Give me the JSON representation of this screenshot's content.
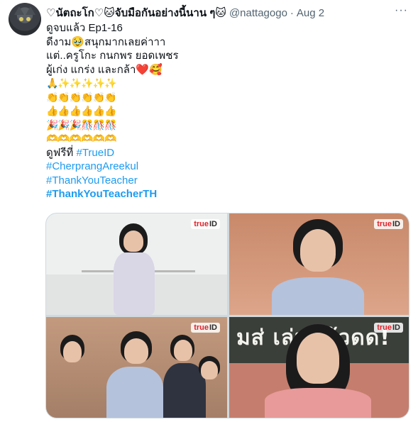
{
  "tweet": {
    "display_name": "♡นัตถะโก♡🐱จับมือกันอย่างนี้นาน ๆ🐱",
    "handle": "@nattagogo",
    "separator": "·",
    "date": "Aug 2",
    "more_label": "···",
    "lines": [
      "ดูจบแล้ว  Ep1-16",
      "ดีงาม🥹สนุกมากเลยค่าาา",
      "แต่..ครูโกะ กนกพร  ยอดเพชร",
      "ผู้เก่ง แกร่ง และกล้า❤️🥰"
    ],
    "emoji_rows": [
      "🙏✨✨✨✨✨",
      "👏👏👏👏👏👏",
      "👍👍👍👍👍👍",
      "🎉🎉🎉🎊🎊🎊",
      "🫶🫶🫶🫶🫶🫶"
    ],
    "watch_text": "ดูฟรีที่ ",
    "hashtags": {
      "trueid": "#TrueID",
      "cherprang": "#CherprangAreekul",
      "thankyou": "#ThankYouTeacher",
      "thankyou_th": "#ThankYouTeacherTH"
    }
  },
  "media": {
    "logo_true": "true",
    "logo_id": "ID",
    "chalk_text": "มส่ เล่นแล้วดด!"
  },
  "colors": {
    "link": "#1d9bf0",
    "secondary_text": "#536471",
    "border": "#cfd9de"
  }
}
